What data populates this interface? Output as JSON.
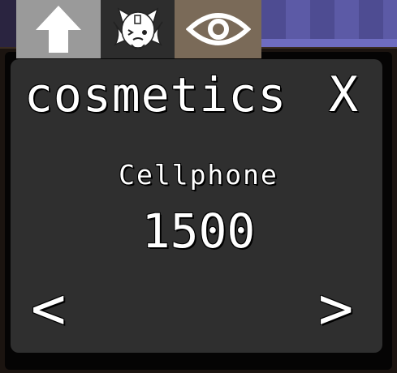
{
  "tabs": [
    {
      "icon": "up-arrow-icon",
      "color": "#9a9a9a"
    },
    {
      "icon": "cat-mask-icon",
      "color": "#2d2d2d"
    },
    {
      "icon": "eye-icon",
      "color": "#7a6a58"
    }
  ],
  "panel": {
    "title": "cosmetics",
    "close_label": "X",
    "item_name": "Cellphone",
    "price": "1500",
    "prev_label": "<",
    "next_label": ">"
  },
  "colors": {
    "panel_background": "#2f2f2f",
    "text": "#ffffff"
  }
}
